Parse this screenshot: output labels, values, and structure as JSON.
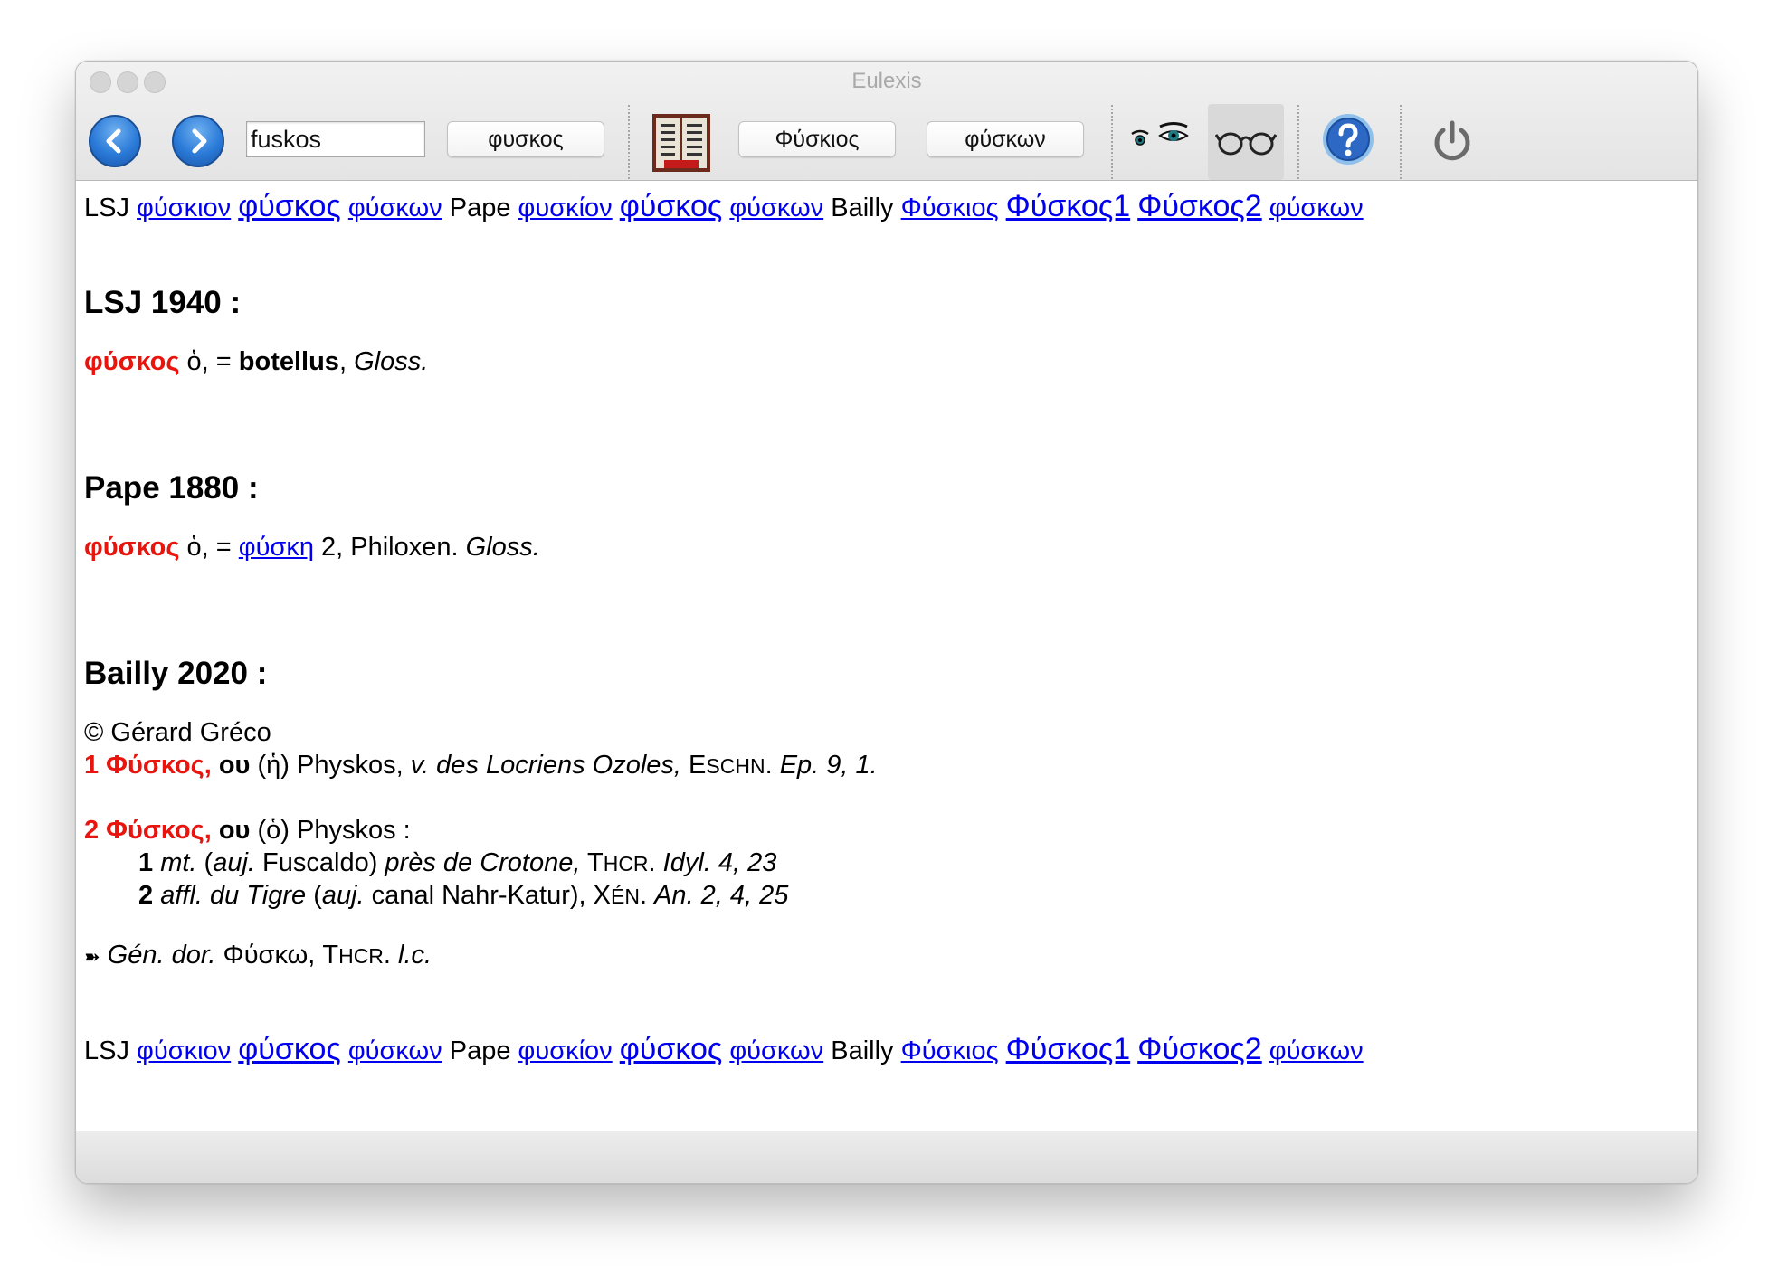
{
  "window": {
    "title": "Eulexis"
  },
  "toolbar": {
    "search_value": "fuskos",
    "btn1": "φυσκος",
    "btn2": "Φύσκιος",
    "btn3": "φύσκων"
  },
  "nav": {
    "lsj_label": "LSJ",
    "lsj_links": [
      "φύσκιον",
      "φύσκος",
      "φύσκων"
    ],
    "pape_label": "Pape",
    "pape_links": [
      "φυσκίον",
      "φύσκος",
      "φύσκων"
    ],
    "bailly_label": "Bailly",
    "bailly_links": [
      "Φύσκιος",
      "Φύσκος1",
      "Φύσκος2",
      "φύσκων"
    ]
  },
  "lsj": {
    "heading": "LSJ 1940 :",
    "headword": "φύσκος",
    "article": " ὁ, = ",
    "gloss_bold": "botellus",
    "comma": ", ",
    "source": "Gloss."
  },
  "pape": {
    "heading": "Pape 1880 :",
    "headword": "φύσκος",
    "article": " ὁ, = ",
    "link": "φύσκη",
    "after": " 2, Philoxen. ",
    "source": "Gloss."
  },
  "bailly": {
    "heading": "Bailly 2020 :",
    "copyright": "© Gérard Gréco",
    "e1_head": "1 Φύσκος,",
    "e1_gen": " ου",
    "e1_art": " (ἡ) Physkos, ",
    "e1_desc": "v. des Locriens Ozoles,",
    "e1_sp": " ",
    "e1_auth_E": "E",
    "e1_auth_rest": "SCHN",
    "e1_dot": ". ",
    "e1_ref": "Ep. 9, 1.",
    "e2_head": "2 Φύσκος,",
    "e2_gen": " ου",
    "e2_art": " (ὁ) Physkos :",
    "s1_num": "1",
    "s1_a": " mt.",
    "s1_b": " (",
    "s1_c": "auj.",
    "s1_d": " Fuscaldo) ",
    "s1_e": "près de Crotone,",
    "s1_f": " ",
    "s1_auth_T": "T",
    "s1_auth_rest": "HCR",
    "s1_g": ". ",
    "s1_ref": "Idyl. 4, 23",
    "s2_num": "2",
    "s2_a": " affl. du Tigre",
    "s2_b": " (",
    "s2_c": "auj.",
    "s2_d": " canal Nahr-Katur), ",
    "s2_auth_X": "X",
    "s2_auth_rest": "ÉN",
    "s2_g": ". ",
    "s2_ref": "An. 2, 4, 25",
    "etym_arrow": "➽",
    "etym_a": " Gén. dor.",
    "etym_b": " Φύσκω, ",
    "etym_auth_T": "T",
    "etym_auth_rest": "HCR",
    "etym_c": ". ",
    "etym_ref": "l.c."
  },
  "colors": {
    "link": "#0000ee",
    "headword": "#e8150f",
    "nav_button": "#2a7ad8"
  },
  "icons": [
    "back-arrow-icon",
    "forward-arrow-icon",
    "greek-dictionary-icon",
    "eye-small-icon",
    "eye-large-icon",
    "glasses-icon",
    "help-icon",
    "power-icon"
  ]
}
